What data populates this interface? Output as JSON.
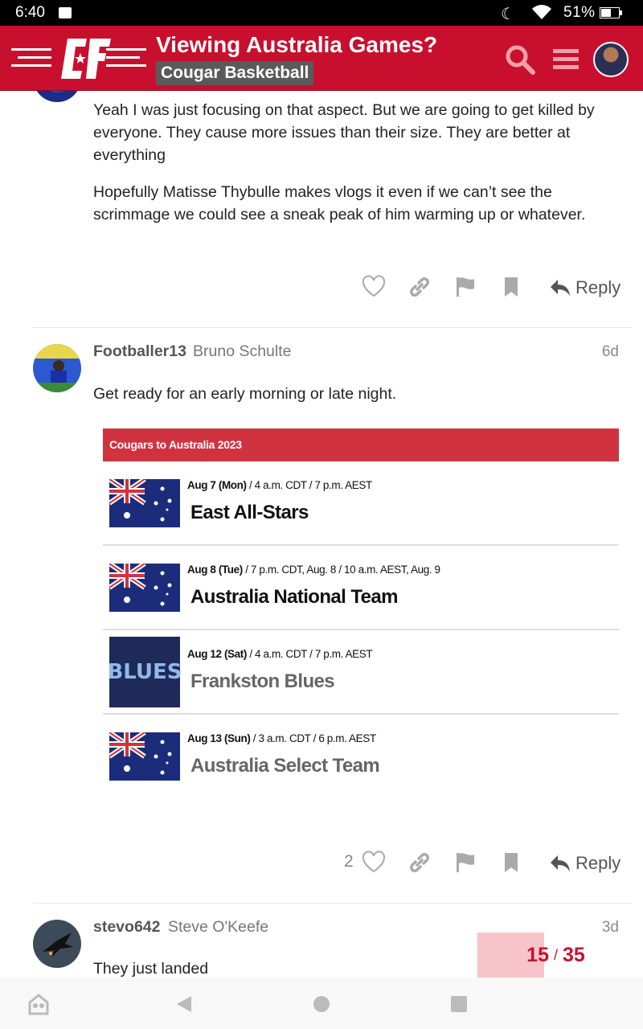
{
  "status_bar": {
    "time": "6:40",
    "battery_percent": "51%",
    "icons": [
      "gallery-icon",
      "moon-icon",
      "wifi-icon",
      "battery-icon"
    ]
  },
  "header": {
    "logo_text": "C★F",
    "title": "Viewing Australia Games?",
    "category": "Cougar Basketball",
    "brand_color": "#c8102e"
  },
  "posts": [
    {
      "paragraphs": [
        "Yeah I was just focusing on that aspect. But we are going to get killed by everyone. They cause more issues than their size. They are better at everything",
        "Hopefully Matisse Thybulle makes vlogs it even if we can’t see the scrimmage we could see a sneak peak of him warming up or whatever."
      ],
      "likes": "",
      "reply_label": "Reply"
    },
    {
      "username": "Footballer13",
      "fullname": "Bruno Schulte",
      "date": "6d",
      "text": "Get ready for an early morning or late night.",
      "likes": "2",
      "reply_label": "Reply",
      "schedule": {
        "title": "Cougars to Australia 2023",
        "games": [
          {
            "date": "Aug 7 (Mon)",
            "time": " / 4 a.m. CDT / 7 p.m. AEST",
            "opponent": "East All-Stars",
            "logo": "australia-flag"
          },
          {
            "date": "Aug 8 (Tue)",
            "time": " / 7 p.m. CDT, Aug. 8 / 10 a.m. AEST, Aug. 9",
            "opponent": "Australia National Team",
            "logo": "australia-flag"
          },
          {
            "date": "Aug 12 (Sat)",
            "time": " / 4 a.m. CDT / 7 p.m. AEST",
            "opponent": "Frankston Blues",
            "logo": "BLUES"
          },
          {
            "date": "Aug 13 (Sun)",
            "time": " / 3 a.m. CDT / 6 p.m. AEST",
            "opponent": "Australia Select Team",
            "logo": "australia-flag"
          }
        ]
      }
    },
    {
      "username": "stevo642",
      "fullname": "Steve O'Keefe",
      "date": "3d",
      "text": "They just landed"
    }
  ],
  "timeline": {
    "current": "15",
    "separator": "/",
    "total": "35",
    "progress_fraction": 0.43
  },
  "navbar": {
    "items": [
      "assistant-icon",
      "back-icon",
      "home-icon",
      "recents-icon"
    ]
  }
}
